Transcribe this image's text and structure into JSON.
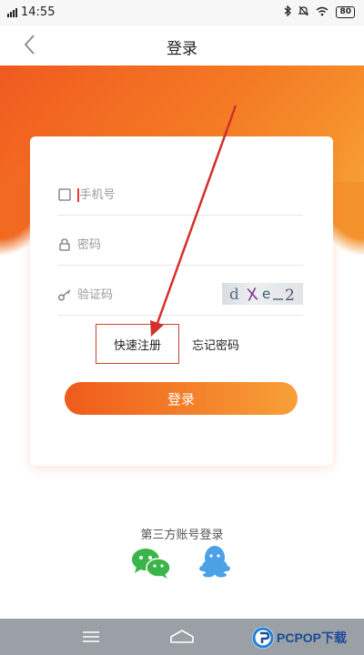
{
  "status_bar": {
    "signal": "4G",
    "time": "14:55",
    "battery": "80"
  },
  "nav": {
    "title": "登录"
  },
  "form": {
    "phone_placeholder": "手机号",
    "password_placeholder": "密码",
    "captcha_placeholder": "验证码",
    "captcha_text": "dXe2"
  },
  "links": {
    "register": "快速注册",
    "forgot": "忘记密码"
  },
  "login_button": "登录",
  "third_party": {
    "label": "第三方账号登录",
    "providers": [
      "wechat-icon",
      "qq-icon"
    ]
  },
  "watermark": {
    "text": "PCPOP下载"
  },
  "colors": {
    "accent_start": "#ef5b1b",
    "accent_end": "#f7a037",
    "annotation": "#d2302a"
  }
}
